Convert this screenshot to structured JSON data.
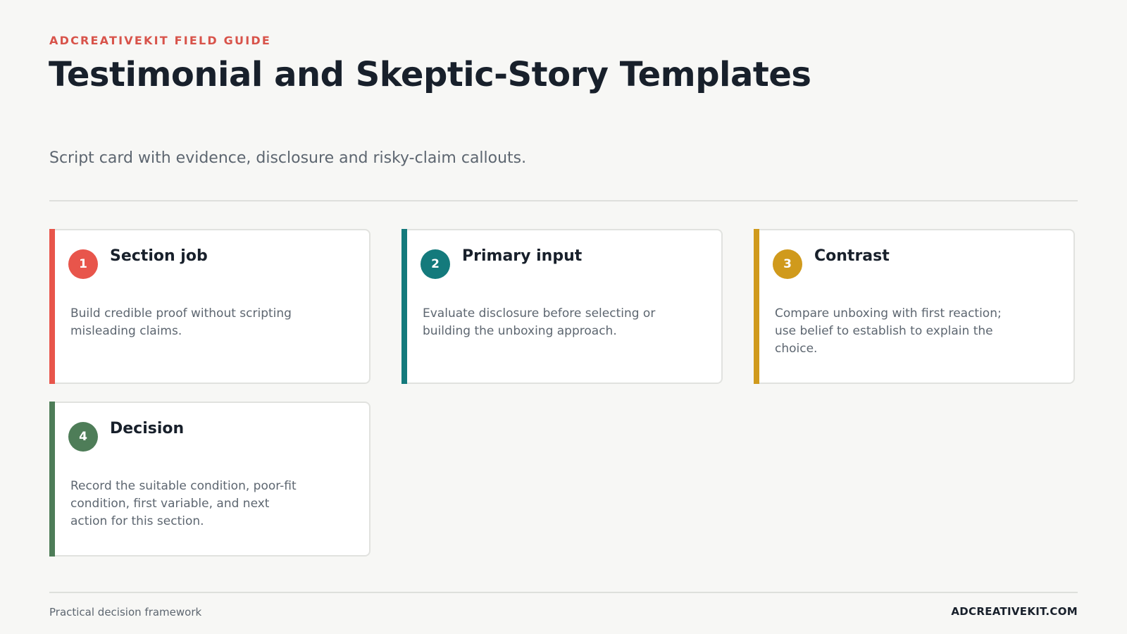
{
  "header": {
    "eyebrow": "ADCREATIVEKIT FIELD GUIDE",
    "title": "Testimonial and Skeptic-Story Templates",
    "subtitle": "Script card with evidence, disclosure and risky-claim callouts."
  },
  "cards": [
    {
      "number": "1",
      "title": "Section job",
      "body": "Build credible proof without scripting misleading claims.",
      "color": "#e8554b"
    },
    {
      "number": "2",
      "title": "Primary input",
      "body": "Evaluate disclosure before selecting or building the unboxing approach.",
      "color": "#147a7c"
    },
    {
      "number": "3",
      "title": "Contrast",
      "body": "Compare unboxing with first reaction; use belief to establish to explain the choice.",
      "color": "#d09a1c"
    },
    {
      "number": "4",
      "title": "Decision",
      "body": "Record the suitable condition, poor-fit condition, first variable, and next action for this section.",
      "color": "#4e7d58"
    }
  ],
  "footer": {
    "left": "Practical decision framework",
    "right": "ADCREATIVEKIT.COM"
  }
}
